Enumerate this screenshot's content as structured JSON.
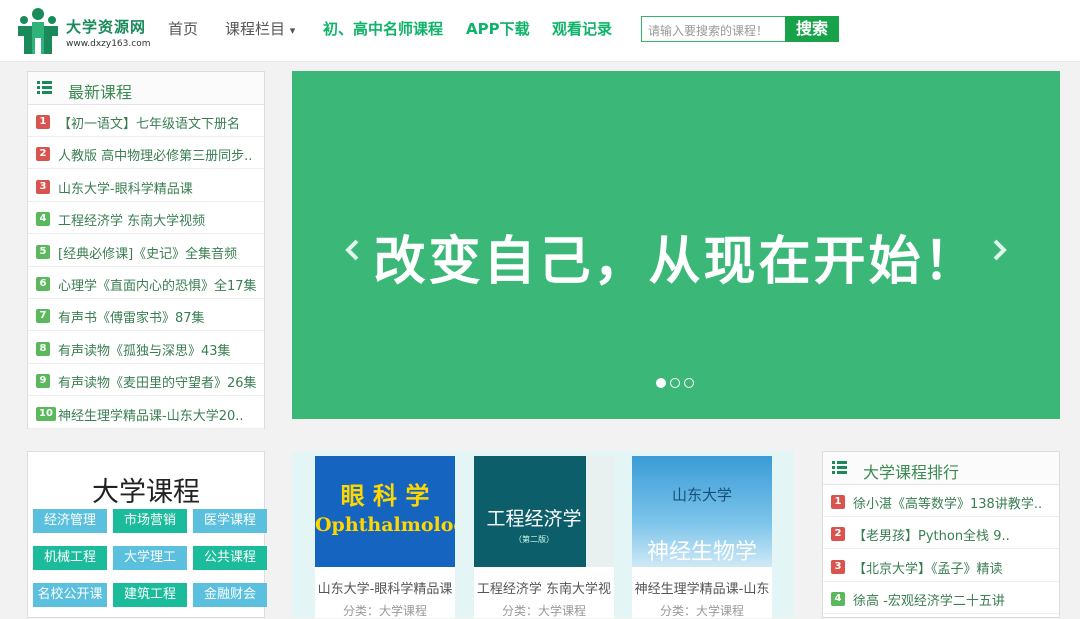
{
  "header": {
    "logo_title": "大学资源网",
    "logo_url": "www.dxzy163.com",
    "nav": [
      {
        "label": "首页",
        "style": "plain"
      },
      {
        "label": "课程栏目",
        "style": "plain",
        "caret": "▾"
      },
      {
        "label": "初、高中名师课程",
        "style": "green"
      },
      {
        "label": "APP下载",
        "style": "green"
      },
      {
        "label": "观看记录",
        "style": "green"
      }
    ],
    "search_placeholder": "请输入要搜索的课程！",
    "search_button": "搜索"
  },
  "latest": {
    "title": "最新课程",
    "items": [
      {
        "num": "1",
        "text": "【初一语文】七年级语文下册名"
      },
      {
        "num": "2",
        "text": "人教版 高中物理必修第三册同步.."
      },
      {
        "num": "3",
        "text": "山东大学-眼科学精品课"
      },
      {
        "num": "4",
        "text": "工程经济学 东南大学视频"
      },
      {
        "num": "5",
        "text": "[经典必修课]《史记》全集音频"
      },
      {
        "num": "6",
        "text": "心理学《直面内心的恐惧》全17集"
      },
      {
        "num": "7",
        "text": "有声书《傅雷家书》87集"
      },
      {
        "num": "8",
        "text": "有声读物《孤独与深思》43集"
      },
      {
        "num": "9",
        "text": "有声读物《麦田里的守望者》26集"
      },
      {
        "num": "10",
        "text": "神经生理学精品课-山东大学20.."
      }
    ]
  },
  "banner": {
    "text": "改变自己，从现在开始！",
    "bg_color": "#3bb878"
  },
  "categories": {
    "title": "大学课程",
    "buttons": [
      {
        "label": "经济管理",
        "color": "#5bc0de"
      },
      {
        "label": "市场营销",
        "color": "#1abc9c"
      },
      {
        "label": "医学课程",
        "color": "#5bc0de"
      },
      {
        "label": "机械工程",
        "color": "#1abc9c"
      },
      {
        "label": "大学理工",
        "color": "#5bc0de"
      },
      {
        "label": "公共课程",
        "color": "#1abc9c"
      },
      {
        "label": "名校公开课",
        "color": "#5bc0de"
      },
      {
        "label": "建筑工程",
        "color": "#1abc9c"
      },
      {
        "label": "金融财会",
        "color": "#5bc0de"
      }
    ]
  },
  "courses": [
    {
      "title": "山东大学-眼科学精品课",
      "category": "分类：大学课程",
      "cover_main": "眼 科 学",
      "cover_sub": "Ophthalmology"
    },
    {
      "title": "工程经济学 东南大学视",
      "category": "分类：大学课程",
      "cover_main": "工程经济学",
      "cover_sub": "（第二版）"
    },
    {
      "title": "神经生理学精品课-山东",
      "category": "分类：大学课程",
      "cover_main": "神经生物学",
      "cover_sub": "山东大学"
    }
  ],
  "ranking": {
    "title": "大学课程排行",
    "items": [
      {
        "num": "1",
        "text": "徐小湛《高等数学》138讲教学.."
      },
      {
        "num": "2",
        "text": "【老男孩】Python全栈 9.."
      },
      {
        "num": "3",
        "text": "【北京大学】《孟子》精读"
      },
      {
        "num": "4",
        "text": "徐高 -宏观经济学二十五讲"
      }
    ]
  },
  "rank_colors": [
    "#d9534f",
    "#d9534f",
    "#d9534f",
    "#5cb85c",
    "#5cb85c",
    "#5cb85c",
    "#5cb85c",
    "#5cb85c",
    "#5cb85c",
    "#5cb85c"
  ]
}
